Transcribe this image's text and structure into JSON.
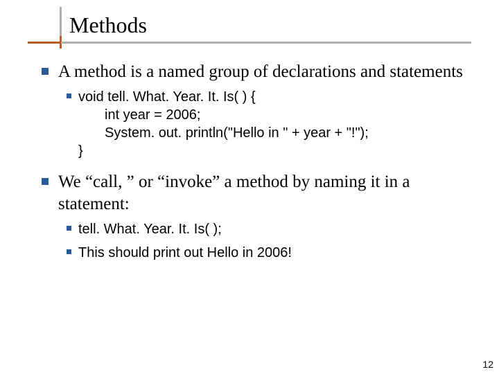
{
  "title": "Methods",
  "bullets": [
    {
      "text": "A method is a named group of declarations and statements",
      "sub": [
        {
          "code": [
            "void tell. What. Year. It. Is( ) {",
            "int year = 2006;",
            "System. out. println(\"Hello in \" + year + \"!\");",
            "}"
          ]
        }
      ]
    },
    {
      "text": "We “call, ” or “invoke” a method by naming it in a statement:",
      "sub": [
        {
          "text": "tell. What. Year. It. Is( );"
        },
        {
          "prefix": "This should print out ",
          "highlight": "Hello in 2006!"
        }
      ]
    }
  ],
  "page_number": "12"
}
